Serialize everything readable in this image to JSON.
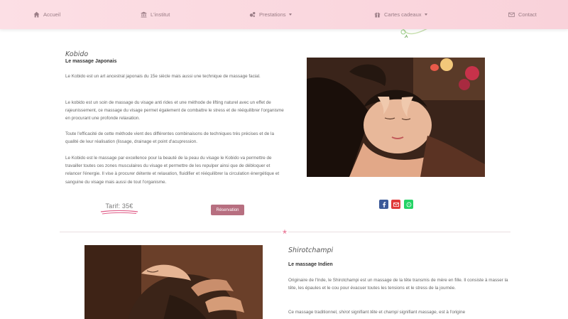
{
  "nav": {
    "items": [
      {
        "label": "Accueil",
        "icon": "home-icon"
      },
      {
        "label": "L'institut",
        "icon": "building-icon"
      },
      {
        "label": "Prestations",
        "icon": "cogs-icon",
        "dropdown": true
      },
      {
        "label": "Cartes cadeaux",
        "icon": "gift-icon",
        "dropdown": true
      },
      {
        "label": "Contact",
        "icon": "envelope-icon"
      }
    ]
  },
  "section1": {
    "title": "Kobido",
    "subtitle": "Le massage Japonais",
    "paragraphs": [
      "Le Kobido est un art ancestral japonais du 15e siècle mais aussi une technique de massage facial.",
      "Le kobido est un soin de massage du visage anti rides et une méthode de lifting naturel avec un effet de rajeunissement, ce massage du visage permet également de combattre le stress et de rééquilibrer l'organisme en procurant une profonde relaxation.",
      "Toute l'efficacité de cette méthode vient des différentes combinaisons de techniques très précises et de la qualité de leur réalisation (lissage, drainage et point d'acupression.",
      "Le Kobido est le massage par excellence pour la beauté de la peau du visage le Kobido va permettre de travailler toutes ces zones musculaires du visage et permettre de les repulper ainsi que de débloquer et relancer l'énergie. Il vise à procurer détente et relaxation, fluidifier et rééquilibrer la circulation énergétique et sanguine du visage mais aussi de tout l'organisme."
    ],
    "price": "Tarif: 35€",
    "reserve_label": "Réservation"
  },
  "share": {
    "icons": [
      "facebook-icon",
      "email-icon",
      "whatsapp-icon"
    ],
    "colors": {
      "facebook": "#3b5998",
      "email": "#e03a3a",
      "whatsapp": "#25d366"
    }
  },
  "section2": {
    "title": "Shirotchampi",
    "subtitle": "Le massage Indien",
    "paragraph1": "Originaire de l'Inde, le Shirotchampi est un massage de la tête transmis de mère en fille. Il consiste à masser la tête, les épaules et le cou pour évacuer toutes les tensions et le stress de la journée.",
    "paragraph2_parts": {
      "a": "Ce massage traditionnel, ",
      "b": "shirot",
      "c": " signifiant ",
      "d": "tête",
      "e": " et ",
      "f": "champi",
      "g": " signifiant ",
      "h": "massage",
      "i": ", est à l'origine"
    }
  },
  "colors": {
    "nav_bg": "#fcdfe5",
    "nav_text": "#9b7d86",
    "accent": "#b76f80",
    "price_underline": "#e0608a"
  }
}
